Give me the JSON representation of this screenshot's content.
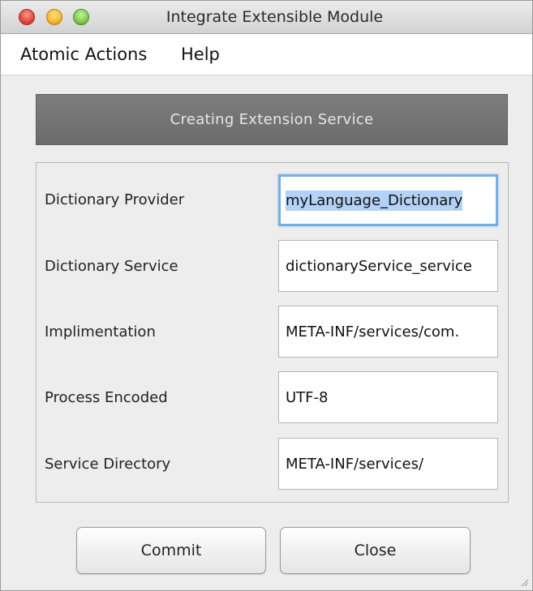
{
  "window": {
    "title": "Integrate Extensible Module"
  },
  "menu": {
    "items": [
      {
        "label": "Atomic Actions"
      },
      {
        "label": "Help"
      }
    ]
  },
  "banner": {
    "text": "Creating Extension Service"
  },
  "form": {
    "rows": [
      {
        "label": "Dictionary Provider",
        "value": "myLanguage_Dictionary"
      },
      {
        "label": "Dictionary Service",
        "value": "dictionaryService_service"
      },
      {
        "label": "Implimentation",
        "value": "META-INF/services/com."
      },
      {
        "label": "Process Encoded",
        "value": "UTF-8"
      },
      {
        "label": "Service Directory",
        "value": "META-INF/services/"
      }
    ]
  },
  "buttons": {
    "commit": "Commit",
    "close": "Close"
  },
  "icons": {
    "close": "close-window-icon",
    "minimize": "minimize-window-icon",
    "zoom": "zoom-window-icon",
    "resize": "resize-grip-icon"
  }
}
